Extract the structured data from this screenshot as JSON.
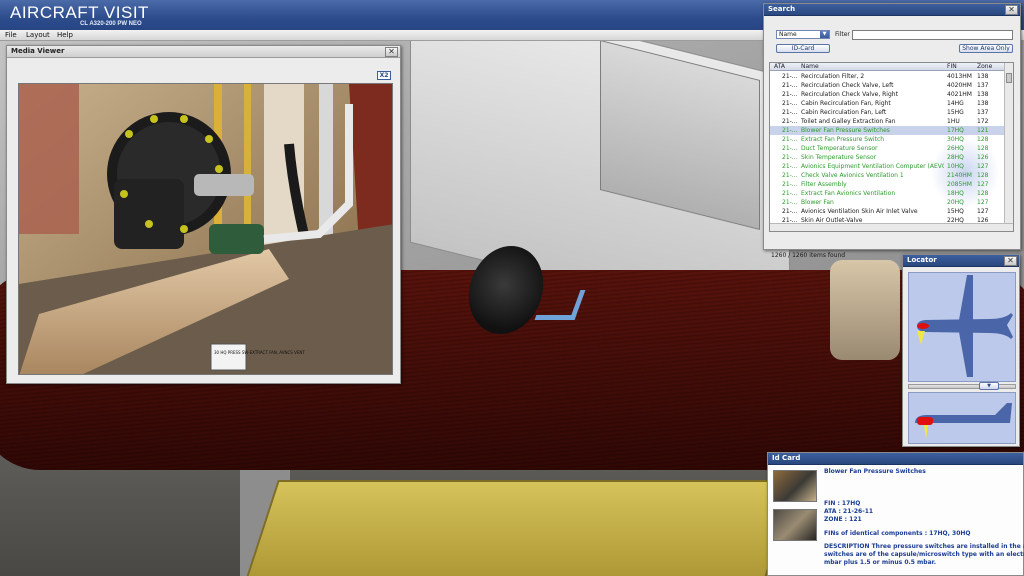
{
  "app": {
    "title": "AIRCRAFT VISIT",
    "subtitle": "CL A320-200 PW NEO"
  },
  "menu": {
    "items": [
      "File",
      "Layout",
      "Help"
    ]
  },
  "media_viewer": {
    "title": "Media Viewer",
    "zoom_label": "X2",
    "photo_label": "30 HQ PRESS SW-EXTRACT FAN, AVNCS VENT"
  },
  "search": {
    "title": "Search",
    "mode_value": "Name",
    "filter_label": "Filter :",
    "filter_value": "",
    "id_card_button": "ID-Card",
    "show_area_button": "Show Area Only",
    "columns": [
      "ATA",
      "Name",
      "FIN",
      "Zone"
    ],
    "rows": [
      {
        "ata": "21-...",
        "name": "Recirculation Filter, 2",
        "fin": "4013HM",
        "zone": "138",
        "status": "normal"
      },
      {
        "ata": "21-...",
        "name": "Recirculation Check Valve, Left",
        "fin": "4020HM",
        "zone": "137",
        "status": "normal"
      },
      {
        "ata": "21-...",
        "name": "Recirculation Check Valve, Right",
        "fin": "4021HM",
        "zone": "138",
        "status": "normal"
      },
      {
        "ata": "21-...",
        "name": "Cabin Recirculation Fan, Right",
        "fin": "14HG",
        "zone": "138",
        "status": "normal"
      },
      {
        "ata": "21-...",
        "name": "Cabin Recirculation Fan, Left",
        "fin": "15HG",
        "zone": "137",
        "status": "normal"
      },
      {
        "ata": "21-...",
        "name": "Toilet and Galley Extraction Fan",
        "fin": "1HU",
        "zone": "172",
        "status": "normal"
      },
      {
        "ata": "21-...",
        "name": "Blower Fan Pressure Switches",
        "fin": "17HQ",
        "zone": "121",
        "status": "selected"
      },
      {
        "ata": "21-...",
        "name": "Extract Fan Pressure Switch",
        "fin": "30HQ",
        "zone": "128",
        "status": "green"
      },
      {
        "ata": "21-...",
        "name": "Duct Temperature Sensor",
        "fin": "26HQ",
        "zone": "128",
        "status": "green"
      },
      {
        "ata": "21-...",
        "name": "Skin Temperature Sensor",
        "fin": "28HQ",
        "zone": "126",
        "status": "green"
      },
      {
        "ata": "21-...",
        "name": "Avionics Equipment Ventilation Computer (AEVC)",
        "fin": "10HQ",
        "zone": "127",
        "status": "green"
      },
      {
        "ata": "21-...",
        "name": "Check Valve Avionics Ventilation 1",
        "fin": "2140HM",
        "zone": "128",
        "status": "green"
      },
      {
        "ata": "21-...",
        "name": "Filter Assembly",
        "fin": "2085HM",
        "zone": "127",
        "status": "green"
      },
      {
        "ata": "21-...",
        "name": "Extract Fan Avionics Ventilation",
        "fin": "18HQ",
        "zone": "128",
        "status": "green"
      },
      {
        "ata": "21-...",
        "name": "Blower Fan",
        "fin": "20HQ",
        "zone": "127",
        "status": "green"
      },
      {
        "ata": "21-...",
        "name": "Avionics Ventilation Skin Air Inlet Valve",
        "fin": "15HQ",
        "zone": "127",
        "status": "normal"
      },
      {
        "ata": "21-...",
        "name": "Skin Air Outlet-Valve",
        "fin": "22HQ",
        "zone": "126",
        "status": "normal"
      }
    ],
    "items_found": "1260 / 1260 items found"
  },
  "locator": {
    "title": "Locator",
    "slider_glyph": "▼"
  },
  "id_card": {
    "title": "Id Card",
    "component_name": "Blower Fan Pressure Switches",
    "fin_line": "FIN : 17HQ",
    "ata_line": "ATA : 21-26-11",
    "zone_line": "ZONE : 121",
    "identical_line": "FINs of identical components : 17HQ, 30HQ",
    "description_lines": [
      "DESCRIPTION Three pressure switches are installed in the avionics",
      "switches are of the capsule/microswitch type with an electrical co",
      "mbar plus 1.5 or minus 0.5 mbar."
    ]
  },
  "colors": {
    "title_blue": "#2d4c8c",
    "green_row": "#2f9a2f",
    "selected_row": "#c8d2ea",
    "marker_red": "#e01010",
    "id_text": "#1b3c95"
  }
}
